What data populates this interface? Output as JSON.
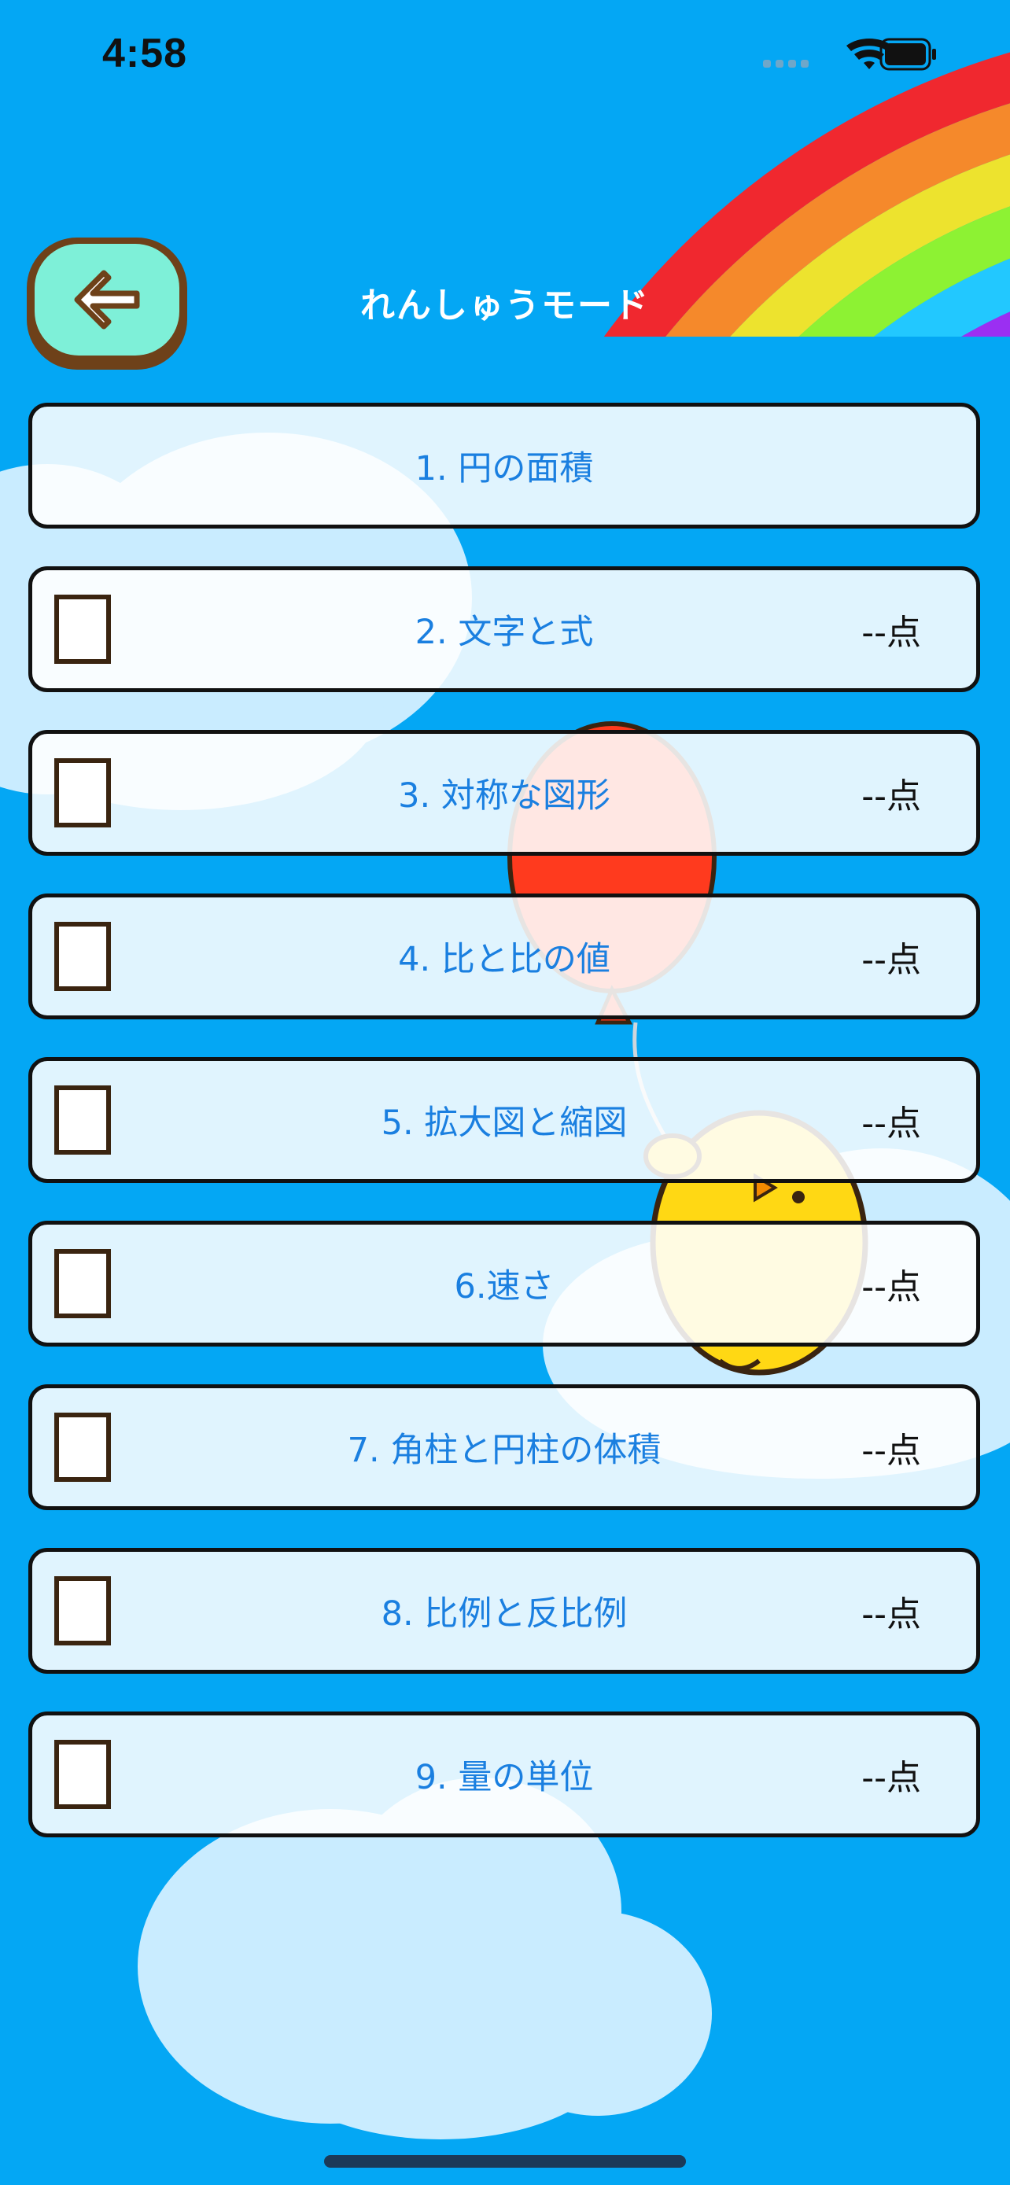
{
  "status_bar": {
    "time": "4:58"
  },
  "header": {
    "title": "れんしゅうモード",
    "back_icon": "arrow-left-icon"
  },
  "lessons": [
    {
      "label": "1. 円の面積",
      "has_checkbox": false,
      "checked": false,
      "score": ""
    },
    {
      "label": "2. 文字と式",
      "has_checkbox": true,
      "checked": false,
      "score": "--点"
    },
    {
      "label": "3. 対称な図形",
      "has_checkbox": true,
      "checked": false,
      "score": "--点"
    },
    {
      "label": "4. 比と比の値",
      "has_checkbox": true,
      "checked": false,
      "score": "--点"
    },
    {
      "label": "5. 拡大図と縮図",
      "has_checkbox": true,
      "checked": false,
      "score": "--点"
    },
    {
      "label": "6.速さ",
      "has_checkbox": true,
      "checked": false,
      "score": "--点"
    },
    {
      "label": "7. 角柱と円柱の体積",
      "has_checkbox": true,
      "checked": false,
      "score": "--点"
    },
    {
      "label": "8. 比例と反比例",
      "has_checkbox": true,
      "checked": false,
      "score": "--点"
    },
    {
      "label": "9. 量の単位",
      "has_checkbox": true,
      "checked": false,
      "score": "--点"
    }
  ],
  "colors": {
    "background": "#04a7f4",
    "row_text": "#1a7fe0",
    "back_button": "#7ef0d8",
    "back_button_border": "#6e4119",
    "rainbow": [
      "#f0282f",
      "#f5892b",
      "#ede32e",
      "#8df233",
      "#22c8ff",
      "#9b2ff2"
    ]
  }
}
